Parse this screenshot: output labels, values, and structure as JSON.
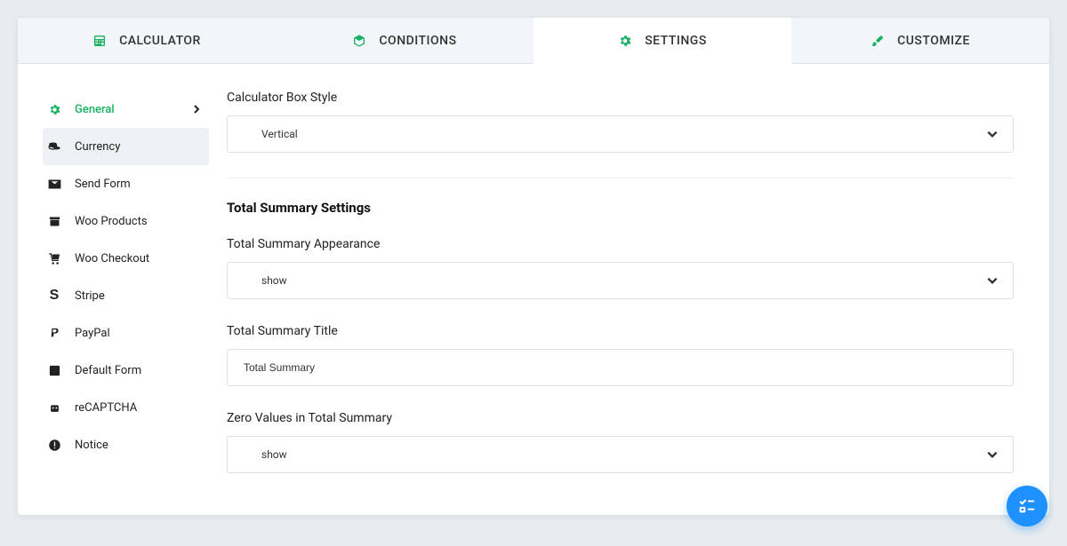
{
  "tabs": {
    "calculator": "CALCULATOR",
    "conditions": "CONDITIONS",
    "settings": "SETTINGS",
    "customize": "CUSTOMIZE"
  },
  "sidebar": {
    "items": [
      {
        "label": "General"
      },
      {
        "label": "Currency"
      },
      {
        "label": "Send Form"
      },
      {
        "label": "Woo Products"
      },
      {
        "label": "Woo Checkout"
      },
      {
        "label": "Stripe"
      },
      {
        "label": "PayPal"
      },
      {
        "label": "Default Form"
      },
      {
        "label": "reCAPTCHA"
      },
      {
        "label": "Notice"
      }
    ]
  },
  "main": {
    "box_style_label": "Calculator Box Style",
    "box_style_value": "Vertical",
    "section_title": "Total Summary Settings",
    "appearance_label": "Total Summary Appearance",
    "appearance_value": "show",
    "title_label": "Total Summary Title",
    "title_value": "Total Summary",
    "zero_label": "Zero Values in Total Summary",
    "zero_value": "show"
  }
}
